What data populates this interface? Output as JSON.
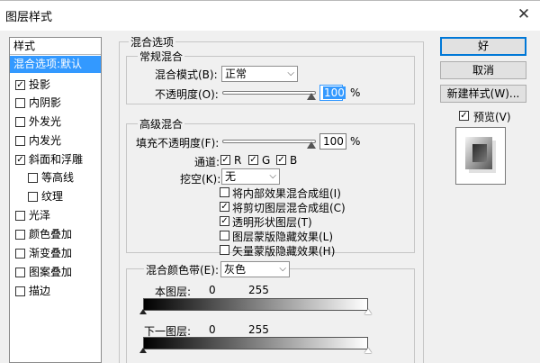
{
  "window": {
    "title": "图层样式"
  },
  "style_list": {
    "header": "样式",
    "items": [
      {
        "label": "混合选项:默认",
        "checkbox": false,
        "checked": false,
        "selected": true,
        "indent": false
      },
      {
        "label": "投影",
        "checkbox": true,
        "checked": true,
        "selected": false,
        "indent": false
      },
      {
        "label": "内阴影",
        "checkbox": true,
        "checked": false,
        "selected": false,
        "indent": false
      },
      {
        "label": "外发光",
        "checkbox": true,
        "checked": false,
        "selected": false,
        "indent": false
      },
      {
        "label": "内发光",
        "checkbox": true,
        "checked": false,
        "selected": false,
        "indent": false
      },
      {
        "label": "斜面和浮雕",
        "checkbox": true,
        "checked": true,
        "selected": false,
        "indent": false
      },
      {
        "label": "等高线",
        "checkbox": true,
        "checked": false,
        "selected": false,
        "indent": true
      },
      {
        "label": "纹理",
        "checkbox": true,
        "checked": false,
        "selected": false,
        "indent": true
      },
      {
        "label": "光泽",
        "checkbox": true,
        "checked": false,
        "selected": false,
        "indent": false
      },
      {
        "label": "颜色叠加",
        "checkbox": true,
        "checked": false,
        "selected": false,
        "indent": false
      },
      {
        "label": "渐变叠加",
        "checkbox": true,
        "checked": false,
        "selected": false,
        "indent": false
      },
      {
        "label": "图案叠加",
        "checkbox": true,
        "checked": false,
        "selected": false,
        "indent": false
      },
      {
        "label": "描边",
        "checkbox": true,
        "checked": false,
        "selected": false,
        "indent": false
      }
    ]
  },
  "blend_options": {
    "title": "混合选项",
    "general": {
      "title": "常规混合",
      "mode_label": "混合模式(B):",
      "mode_value": "正常",
      "opacity_label": "不透明度(O):",
      "opacity_value": "100",
      "opacity_unit": "%"
    },
    "advanced": {
      "title": "高级混合",
      "fill_opacity_label": "填充不透明度(F):",
      "fill_opacity_value": "100",
      "fill_opacity_unit": "%",
      "channels_label": "通道:",
      "channel_r": "R",
      "channel_g": "G",
      "channel_b": "B",
      "knockout_label": "挖空(K):",
      "knockout_value": "无",
      "checkboxes": [
        {
          "label": "将内部效果混合成组(I)",
          "checked": false
        },
        {
          "label": "将剪切图层混合成组(C)",
          "checked": true
        },
        {
          "label": "透明形状图层(T)",
          "checked": true
        },
        {
          "label": "图层蒙版隐藏效果(L)",
          "checked": false
        },
        {
          "label": "矢量蒙版隐藏效果(H)",
          "checked": false
        }
      ]
    },
    "blend_if": {
      "label": "混合颜色带(E):",
      "value": "灰色",
      "this_layer_label": "本图层:",
      "this_layer_low": "0",
      "this_layer_high": "255",
      "underlying_label": "下一图层:",
      "underlying_low": "0",
      "underlying_high": "255"
    }
  },
  "buttons": {
    "ok": "好",
    "cancel": "取消",
    "new_style": "新建样式(W)...",
    "preview_label": "预览(V)",
    "preview_checked": true
  },
  "colors": {
    "selection": "#3399ff",
    "dialog_bg": "#f0f0f0",
    "default_button_border": "#0078d7"
  }
}
